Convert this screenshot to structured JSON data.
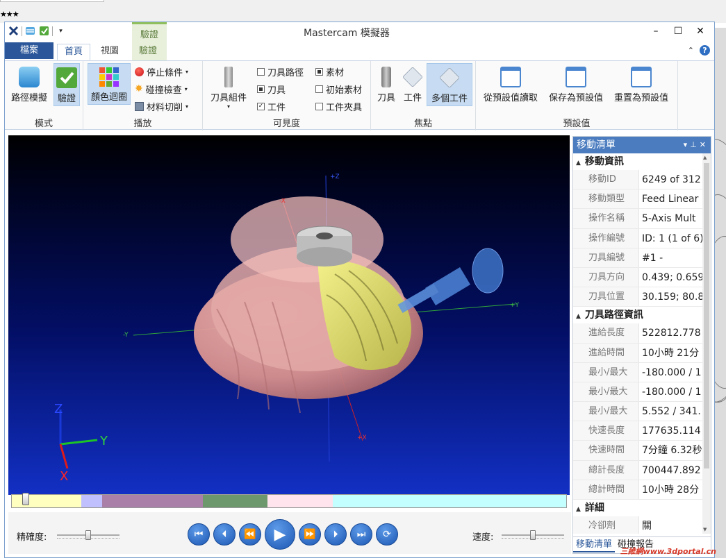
{
  "app": {
    "title": "Mastercam 模擬器",
    "stars": "★★★"
  },
  "qat_icons": [
    "mastercam-logo-icon",
    "backplot-icon",
    "verify-icon",
    "customize-qat-icon"
  ],
  "contextual": {
    "label": "驗證"
  },
  "tabs": {
    "file": "檔案",
    "home": "首頁",
    "view": "視圖",
    "verify": "驗證"
  },
  "ribbon": {
    "mode": {
      "label": "模式",
      "backplot": "路徑模擬",
      "verify": "驗證"
    },
    "playback": {
      "label": "播放",
      "color_loop": "顏色迴圈",
      "stop_conditions": "停止條件",
      "collision_check": "碰撞檢查",
      "material_removal": "材料切削"
    },
    "visibility": {
      "label": "可見度",
      "tool_assembly": "刀具組件",
      "toolpath": "刀具路徑",
      "tool": "刀具",
      "workpiece": "工件",
      "stock": "素材",
      "initial_stock": "初始素材",
      "fixture": "工件夾具"
    },
    "focus": {
      "label": "焦點",
      "tool": "刀具",
      "workpiece": "工件",
      "multi": "多個工件"
    },
    "presets": {
      "label": "預設值",
      "read": "從預設值讀取",
      "save": "保存為預設值",
      "reset": "重置為預設值"
    }
  },
  "viewport": {
    "axis_labels": {
      "x": "X",
      "y": "Y",
      "z": "Z",
      "pz": "+Z",
      "py": "+Y",
      "ny": "-Y",
      "px": "+X",
      "nx": "-X"
    }
  },
  "timeline": {
    "colors": [
      "#ffffc0",
      "#c0c0ff",
      "#aa7fa8",
      "#6d986e",
      "#ffe4ee",
      "#c4ffff"
    ],
    "position": 0.02
  },
  "controls": {
    "precision_label": "精確度:",
    "speed_label": "速度:",
    "precision_level": 0.5,
    "speed_level": 0.5
  },
  "panel": {
    "title": "移動清單",
    "sections": [
      {
        "title": "移動資訊",
        "rows": [
          {
            "k": "移動ID",
            "v": "6249 of 312"
          },
          {
            "k": "移動類型",
            "v": "Feed Linear"
          },
          {
            "k": "操作名稱",
            "v": "5-Axis Mult"
          },
          {
            "k": "操作編號",
            "v": "ID: 1 (1 of 6)"
          },
          {
            "k": "刀具編號",
            "v": "#1 -"
          },
          {
            "k": "刀具方向",
            "v": "0.439; 0.659"
          },
          {
            "k": "刀具位置",
            "v": "30.159; 80.8"
          }
        ]
      },
      {
        "title": "刀具路徑資訊",
        "rows": [
          {
            "k": "進給長度",
            "v": "522812.778"
          },
          {
            "k": "進給時間",
            "v": "10小時 21分"
          },
          {
            "k": "最小/最大",
            "v": "-180.000 / 1"
          },
          {
            "k": "最小/最大",
            "v": "-180.000 / 1"
          },
          {
            "k": "最小/最大",
            "v": "5.552 / 341."
          },
          {
            "k": "快速長度",
            "v": "177635.114"
          },
          {
            "k": "快速時間",
            "v": "7分鐘 6.32秒"
          },
          {
            "k": "總計長度",
            "v": "700447.892"
          },
          {
            "k": "總計時間",
            "v": "10小時 28分"
          }
        ]
      },
      {
        "title": "詳細",
        "rows": [
          {
            "k": "冷卻劑",
            "v": "關"
          }
        ]
      }
    ],
    "tabs": [
      "移動清單",
      "碰撞報告"
    ]
  },
  "watermark": "三維網www.3dportal.cn"
}
